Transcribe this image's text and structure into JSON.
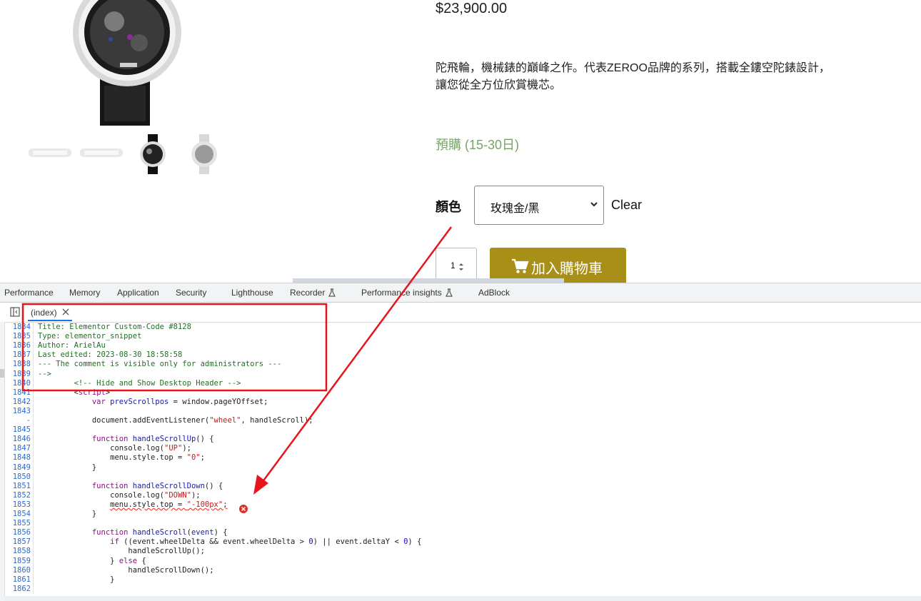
{
  "product": {
    "price": "$23,900.00",
    "description": "陀飛輪，機械錶的巔峰之作。代表ZEROO品牌的系列，搭載全鏤空陀錶設計，讓您從全方位欣賞機芯。",
    "stock_status": "預購 (15-30日)",
    "color_label": "顏色",
    "color_value": "玫瑰金/黑",
    "clear_label": "Clear",
    "quantity": "1",
    "add_to_cart_label": "加入購物車"
  },
  "devtools": {
    "tabs": [
      {
        "label": "Performance",
        "experimental": false
      },
      {
        "label": "Memory",
        "experimental": false
      },
      {
        "label": "Application",
        "experimental": false
      },
      {
        "label": "Security",
        "experimental": false
      },
      {
        "label": "Lighthouse",
        "experimental": false
      },
      {
        "label": "Recorder",
        "experimental": true
      },
      {
        "label": "Performance insights",
        "experimental": true
      },
      {
        "label": "AdBlock",
        "experimental": false
      }
    ],
    "open_file": "(index)",
    "line_numbers": [
      "1834",
      "1835",
      "1836",
      "1837",
      "1838",
      "1839",
      "1840",
      "1841",
      "1842",
      "1843",
      "-",
      "1845",
      "1846",
      "1847",
      "1848",
      "1849",
      "1850",
      "1851",
      "1852",
      "1853",
      "1854",
      "1855",
      "1856",
      "1857",
      "1858",
      "1859",
      "1860",
      "1861",
      "1862"
    ],
    "code_lines": [
      [
        {
          "t": "Title: Elementor Custom-Code #8128",
          "c": "cm"
        }
      ],
      [
        {
          "t": "Type: elementor_snippet",
          "c": "cm"
        }
      ],
      [
        {
          "t": "Author: ArielAu",
          "c": "cm"
        }
      ],
      [
        {
          "t": "Last edited: 2023-08-30 18:58:58",
          "c": "cm"
        }
      ],
      [
        {
          "t": "--- The comment is visible only for administrators ---",
          "c": "cm"
        }
      ],
      [
        {
          "t": "-->",
          "c": "cm"
        }
      ],
      [
        {
          "t": "        "
        },
        {
          "t": "<!-- Hide and Show Desktop Header -->",
          "c": "cm"
        }
      ],
      [
        {
          "t": "        <"
        },
        {
          "t": "script",
          "c": "tag"
        },
        {
          "t": ">"
        }
      ],
      [
        {
          "t": "            "
        },
        {
          "t": "var",
          "c": "kw"
        },
        {
          "t": " "
        },
        {
          "t": "prevScrollpos",
          "c": "fn"
        },
        {
          "t": " = window.pageYOffset;"
        }
      ],
      [],
      [
        {
          "t": "            document.addEventListener("
        },
        {
          "t": "\"wheel\"",
          "c": "st"
        },
        {
          "t": ", handleScroll);"
        }
      ],
      [],
      [
        {
          "t": "            "
        },
        {
          "t": "function",
          "c": "kw"
        },
        {
          "t": " "
        },
        {
          "t": "handleScrollUp",
          "c": "fn"
        },
        {
          "t": "() {"
        }
      ],
      [
        {
          "t": "                console.log("
        },
        {
          "t": "\"UP\"",
          "c": "st"
        },
        {
          "t": ");"
        }
      ],
      [
        {
          "t": "                menu.style.top = "
        },
        {
          "t": "\"0\"",
          "c": "st"
        },
        {
          "t": ";"
        }
      ],
      [
        {
          "t": "            }"
        }
      ],
      [],
      [
        {
          "t": "            "
        },
        {
          "t": "function",
          "c": "kw"
        },
        {
          "t": " "
        },
        {
          "t": "handleScrollDown",
          "c": "fn"
        },
        {
          "t": "() {"
        }
      ],
      [
        {
          "t": "                console.log("
        },
        {
          "t": "\"DOWN\"",
          "c": "st"
        },
        {
          "t": ");"
        }
      ],
      [
        {
          "t": "                "
        },
        {
          "t": "menu.style.top = ",
          "c": "err-underline"
        },
        {
          "t": "\"-100px\"",
          "c": "st err-underline"
        },
        {
          "t": ";",
          "c": "err-underline"
        }
      ],
      [
        {
          "t": "            }"
        }
      ],
      [],
      [
        {
          "t": "            "
        },
        {
          "t": "function",
          "c": "kw"
        },
        {
          "t": " "
        },
        {
          "t": "handleScroll",
          "c": "fn"
        },
        {
          "t": "("
        },
        {
          "t": "event",
          "c": "fn"
        },
        {
          "t": ") {"
        }
      ],
      [
        {
          "t": "                "
        },
        {
          "t": "if",
          "c": "kw"
        },
        {
          "t": " ((event.wheelDelta && event.wheelDelta > "
        },
        {
          "t": "0",
          "c": "nm"
        },
        {
          "t": ") || event.deltaY < "
        },
        {
          "t": "0",
          "c": "nm"
        },
        {
          "t": ") {"
        }
      ],
      [
        {
          "t": "                    handleScrollUp();"
        }
      ],
      [
        {
          "t": "                } "
        },
        {
          "t": "else",
          "c": "kw"
        },
        {
          "t": " {"
        }
      ],
      [
        {
          "t": "                    handleScrollDown();"
        }
      ],
      [
        {
          "t": "                }"
        }
      ],
      []
    ]
  },
  "colors": {
    "stock_green": "#77a464",
    "cart_button": "#a88f18",
    "annotation_red": "#e8141c",
    "line_number_blue": "#2a6bd0"
  }
}
